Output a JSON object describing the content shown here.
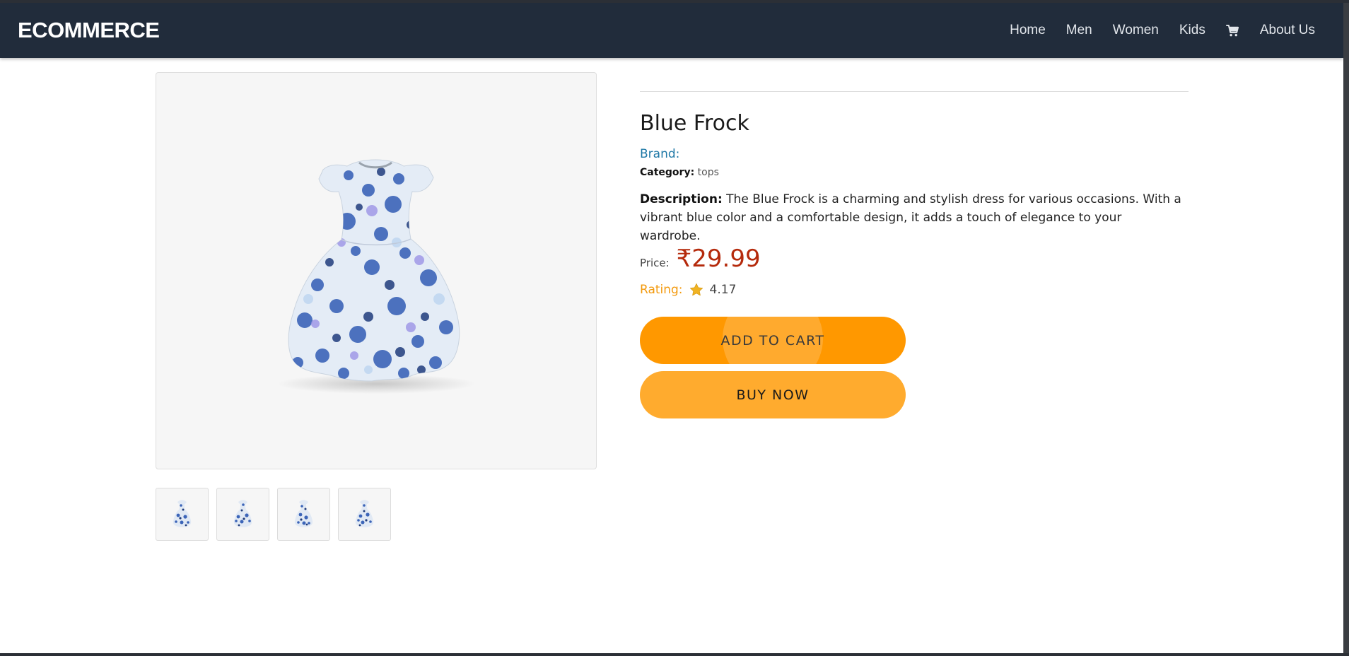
{
  "navbar": {
    "brand": "ECOMMERCE",
    "links": [
      "Home",
      "Men",
      "Women",
      "Kids"
    ],
    "about": "About Us",
    "cart_icon": "cart-icon"
  },
  "product": {
    "title": "Blue Frock",
    "brand_label": "Brand:",
    "brand_value": "",
    "category_label": "Category:",
    "category_value": "tops",
    "description_label": "Description:",
    "description": "The Blue Frock is a charming and stylish dress for various occasions. With a vibrant blue color and a comfortable design, it adds a touch of elegance to your wardrobe.",
    "price_label": "Price:",
    "price": "₹29.99",
    "rating_label": "Rating:",
    "rating": "4.17",
    "rating_icon": "star-icon",
    "image_icon": "dress-image"
  },
  "thumbnails": [
    "dress-thumbnail-1",
    "dress-thumbnail-2",
    "dress-thumbnail-3",
    "dress-thumbnail-4"
  ],
  "actions": {
    "add_to_cart": "ADD TO CART",
    "buy_now": "BUY NOW"
  },
  "colors": {
    "navbar_bg": "#212c3b",
    "price": "#b52a0c",
    "brand_link": "#1f78a6",
    "rating_label": "#f39a0e",
    "add_to_cart_bg": "#ff9800",
    "buy_now_bg": "#ffab2e"
  }
}
